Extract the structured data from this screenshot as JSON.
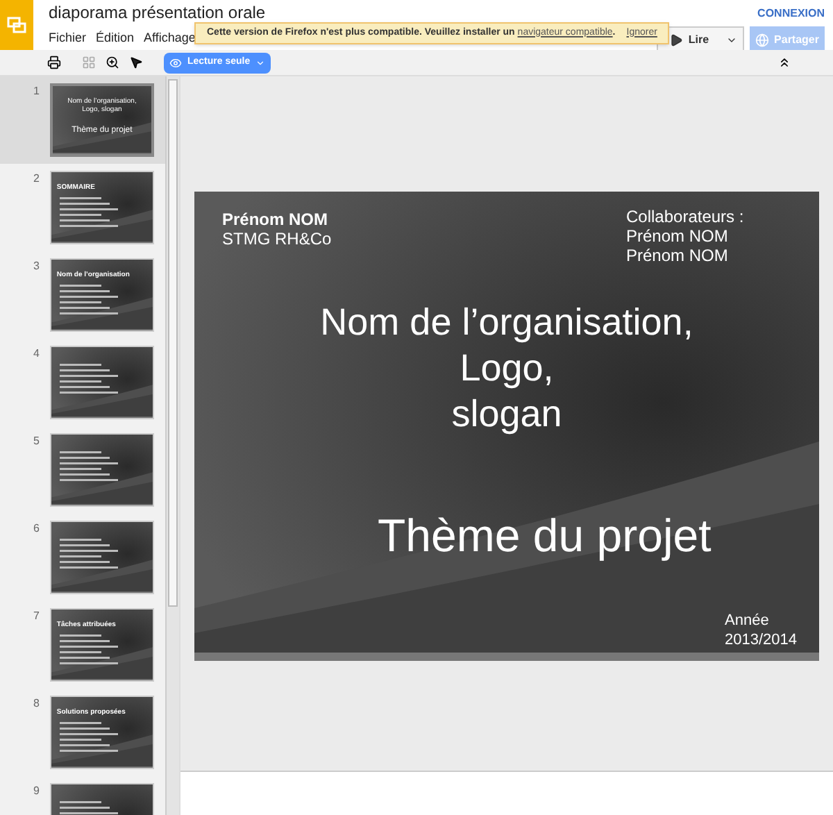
{
  "header": {
    "title": "diaporama présentation orale",
    "menu": [
      "Fichier",
      "Édition",
      "Affichage"
    ],
    "signin": "CONNEXION"
  },
  "notice": {
    "text": "Cette version de Firefox n'est plus compatible. Veuillez installer un",
    "link": "navigateur compatible",
    "after": ".",
    "dismiss": "Ignorer"
  },
  "buttons": {
    "play": "Lire",
    "share": "Partager"
  },
  "toolbar": {
    "mode": "Lecture seule"
  },
  "thumbnails": [
    {
      "number": "1",
      "selected": true,
      "title": "Nom de l’organisation, Logo, slogan",
      "subtitle": "Thème du projet"
    },
    {
      "number": "2",
      "selected": false,
      "title": "SOMMAIRE"
    },
    {
      "number": "3",
      "selected": false,
      "title": "Nom de l’organisation"
    },
    {
      "number": "4",
      "selected": false
    },
    {
      "number": "5",
      "selected": false
    },
    {
      "number": "6",
      "selected": false
    },
    {
      "number": "7",
      "selected": false,
      "title": "Tâches attribuées"
    },
    {
      "number": "8",
      "selected": false,
      "title": "Solutions proposées"
    },
    {
      "number": "9",
      "selected": false
    }
  ],
  "slide": {
    "author": "Prénom NOM",
    "class": "STMG RH&Co",
    "collaborators": [
      "Collaborateurs :",
      "Prénom NOM",
      "Prénom NOM"
    ],
    "title": [
      "Nom de l’organisation,",
      "Logo,",
      "slogan"
    ],
    "theme": "Thème du projet",
    "year": [
      "Année",
      "2013/2014"
    ]
  }
}
